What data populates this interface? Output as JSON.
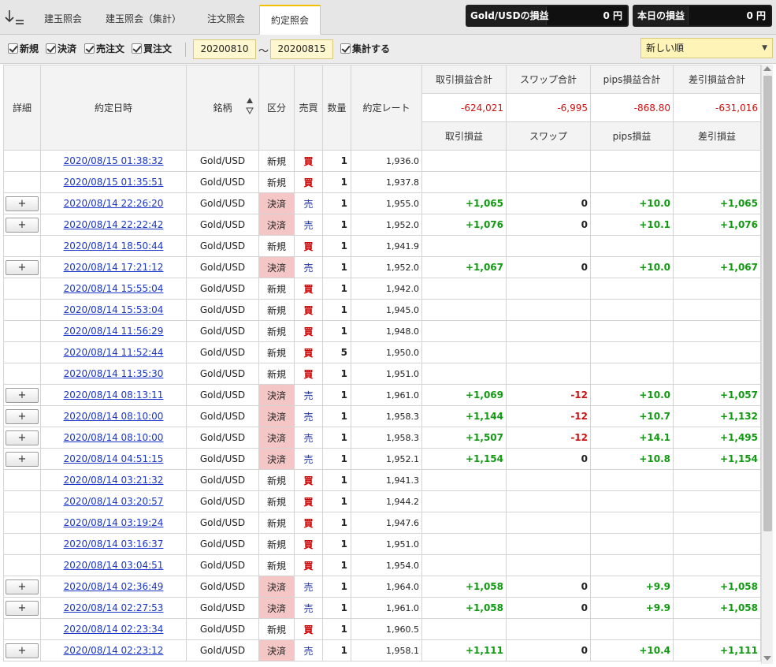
{
  "tabs": [
    {
      "label": "建玉照会"
    },
    {
      "label": "建玉照会（集計）"
    },
    {
      "label": "注文照会"
    },
    {
      "label": "約定照会"
    }
  ],
  "pl_summary": {
    "gold_label": "Gold/USDの損益",
    "gold_value": "0 円",
    "today_label": "本日の損益",
    "today_value": "0 円"
  },
  "filters": {
    "new_label": "新規",
    "settle_label": "決済",
    "sell_label": "売注文",
    "buy_label": "買注文",
    "date_from": "20200810",
    "tilde": "～",
    "date_to": "20200815",
    "aggregate_label": "集計する",
    "sort_order": "新しい順"
  },
  "table": {
    "headers": {
      "detail": "詳細",
      "datetime": "約定日時",
      "symbol": "銘柄",
      "kubun": "区分",
      "side": "売買",
      "qty": "数量",
      "rate": "約定レート",
      "trade_pl_total": "取引損益合計",
      "swap_total": "スワップ合計",
      "pips_total": "pips損益合計",
      "net_total": "差引損益合計",
      "trade_pl": "取引損益",
      "swap": "スワップ",
      "pips": "pips損益",
      "net": "差引損益"
    },
    "totals": {
      "trade_pl": "-624,021",
      "swap": "-6,995",
      "pips": "-868.80",
      "net": "-631,016"
    },
    "plus_label": "+",
    "rows": [
      {
        "datetime": "2020/08/15 01:38:32",
        "symbol": "Gold/USD",
        "kubun": "新規",
        "side": "買",
        "qty": "1",
        "rate": "1,936.0",
        "trade_pl": "",
        "swap": "",
        "pips": "",
        "net": ""
      },
      {
        "datetime": "2020/08/15 01:35:51",
        "symbol": "Gold/USD",
        "kubun": "新規",
        "side": "買",
        "qty": "1",
        "rate": "1,937.8",
        "trade_pl": "",
        "swap": "",
        "pips": "",
        "net": ""
      },
      {
        "datetime": "2020/08/14 22:26:20",
        "symbol": "Gold/USD",
        "kubun": "決済",
        "side": "売",
        "qty": "1",
        "rate": "1,955.0",
        "trade_pl": "+1,065",
        "swap": "0",
        "pips": "+10.0",
        "net": "+1,065"
      },
      {
        "datetime": "2020/08/14 22:22:42",
        "symbol": "Gold/USD",
        "kubun": "決済",
        "side": "売",
        "qty": "1",
        "rate": "1,952.0",
        "trade_pl": "+1,076",
        "swap": "0",
        "pips": "+10.1",
        "net": "+1,076"
      },
      {
        "datetime": "2020/08/14 18:50:44",
        "symbol": "Gold/USD",
        "kubun": "新規",
        "side": "買",
        "qty": "1",
        "rate": "1,941.9",
        "trade_pl": "",
        "swap": "",
        "pips": "",
        "net": ""
      },
      {
        "datetime": "2020/08/14 17:21:12",
        "symbol": "Gold/USD",
        "kubun": "決済",
        "side": "売",
        "qty": "1",
        "rate": "1,952.0",
        "trade_pl": "+1,067",
        "swap": "0",
        "pips": "+10.0",
        "net": "+1,067"
      },
      {
        "datetime": "2020/08/14 15:55:04",
        "symbol": "Gold/USD",
        "kubun": "新規",
        "side": "買",
        "qty": "1",
        "rate": "1,942.0",
        "trade_pl": "",
        "swap": "",
        "pips": "",
        "net": ""
      },
      {
        "datetime": "2020/08/14 15:53:04",
        "symbol": "Gold/USD",
        "kubun": "新規",
        "side": "買",
        "qty": "1",
        "rate": "1,945.0",
        "trade_pl": "",
        "swap": "",
        "pips": "",
        "net": ""
      },
      {
        "datetime": "2020/08/14 11:56:29",
        "symbol": "Gold/USD",
        "kubun": "新規",
        "side": "買",
        "qty": "1",
        "rate": "1,948.0",
        "trade_pl": "",
        "swap": "",
        "pips": "",
        "net": ""
      },
      {
        "datetime": "2020/08/14 11:52:44",
        "symbol": "Gold/USD",
        "kubun": "新規",
        "side": "買",
        "qty": "5",
        "rate": "1,950.0",
        "trade_pl": "",
        "swap": "",
        "pips": "",
        "net": ""
      },
      {
        "datetime": "2020/08/14 11:35:30",
        "symbol": "Gold/USD",
        "kubun": "新規",
        "side": "買",
        "qty": "1",
        "rate": "1,951.0",
        "trade_pl": "",
        "swap": "",
        "pips": "",
        "net": ""
      },
      {
        "datetime": "2020/08/14 08:13:11",
        "symbol": "Gold/USD",
        "kubun": "決済",
        "side": "売",
        "qty": "1",
        "rate": "1,961.0",
        "trade_pl": "+1,069",
        "swap": "-12",
        "pips": "+10.0",
        "net": "+1,057"
      },
      {
        "datetime": "2020/08/14 08:10:00",
        "symbol": "Gold/USD",
        "kubun": "決済",
        "side": "売",
        "qty": "1",
        "rate": "1,958.3",
        "trade_pl": "+1,144",
        "swap": "-12",
        "pips": "+10.7",
        "net": "+1,132"
      },
      {
        "datetime": "2020/08/14 08:10:00",
        "symbol": "Gold/USD",
        "kubun": "決済",
        "side": "売",
        "qty": "1",
        "rate": "1,958.3",
        "trade_pl": "+1,507",
        "swap": "-12",
        "pips": "+14.1",
        "net": "+1,495"
      },
      {
        "datetime": "2020/08/14 04:51:15",
        "symbol": "Gold/USD",
        "kubun": "決済",
        "side": "売",
        "qty": "1",
        "rate": "1,952.1",
        "trade_pl": "+1,154",
        "swap": "0",
        "pips": "+10.8",
        "net": "+1,154"
      },
      {
        "datetime": "2020/08/14 03:21:32",
        "symbol": "Gold/USD",
        "kubun": "新規",
        "side": "買",
        "qty": "1",
        "rate": "1,941.3",
        "trade_pl": "",
        "swap": "",
        "pips": "",
        "net": ""
      },
      {
        "datetime": "2020/08/14 03:20:57",
        "symbol": "Gold/USD",
        "kubun": "新規",
        "side": "買",
        "qty": "1",
        "rate": "1,944.2",
        "trade_pl": "",
        "swap": "",
        "pips": "",
        "net": ""
      },
      {
        "datetime": "2020/08/14 03:19:24",
        "symbol": "Gold/USD",
        "kubun": "新規",
        "side": "買",
        "qty": "1",
        "rate": "1,947.6",
        "trade_pl": "",
        "swap": "",
        "pips": "",
        "net": ""
      },
      {
        "datetime": "2020/08/14 03:16:37",
        "symbol": "Gold/USD",
        "kubun": "新規",
        "side": "買",
        "qty": "1",
        "rate": "1,951.0",
        "trade_pl": "",
        "swap": "",
        "pips": "",
        "net": ""
      },
      {
        "datetime": "2020/08/14 03:04:51",
        "symbol": "Gold/USD",
        "kubun": "新規",
        "side": "買",
        "qty": "1",
        "rate": "1,954.0",
        "trade_pl": "",
        "swap": "",
        "pips": "",
        "net": ""
      },
      {
        "datetime": "2020/08/14 02:36:49",
        "symbol": "Gold/USD",
        "kubun": "決済",
        "side": "売",
        "qty": "1",
        "rate": "1,964.0",
        "trade_pl": "+1,058",
        "swap": "0",
        "pips": "+9.9",
        "net": "+1,058"
      },
      {
        "datetime": "2020/08/14 02:27:53",
        "symbol": "Gold/USD",
        "kubun": "決済",
        "side": "売",
        "qty": "1",
        "rate": "1,961.0",
        "trade_pl": "+1,058",
        "swap": "0",
        "pips": "+9.9",
        "net": "+1,058"
      },
      {
        "datetime": "2020/08/14 02:23:34",
        "symbol": "Gold/USD",
        "kubun": "新規",
        "side": "買",
        "qty": "1",
        "rate": "1,960.5",
        "trade_pl": "",
        "swap": "",
        "pips": "",
        "net": ""
      },
      {
        "datetime": "2020/08/14 02:23:12",
        "symbol": "Gold/USD",
        "kubun": "決済",
        "side": "売",
        "qty": "1",
        "rate": "1,958.1",
        "trade_pl": "+1,111",
        "swap": "0",
        "pips": "+10.4",
        "net": "+1,111"
      }
    ]
  },
  "colors": {
    "accent_tab": "#f2c200",
    "settle_cell": "#f4c6c6",
    "buy": "#cc0000",
    "sell": "#2233aa",
    "positive": "#119a11",
    "negative": "#d01010",
    "link": "#1a35c8"
  }
}
